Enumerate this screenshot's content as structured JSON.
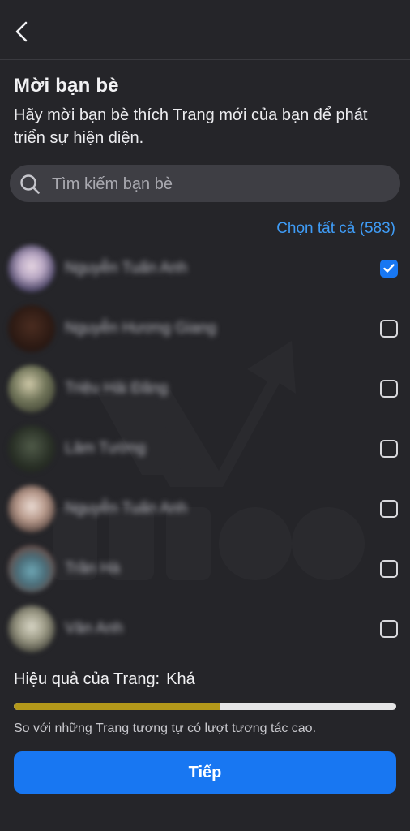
{
  "header": {
    "back_icon": "chevron-left-icon"
  },
  "page": {
    "title": "Mời bạn bè",
    "subtitle": "Hãy mời bạn bè thích Trang mới của bạn để phát triển sự hiện diện."
  },
  "search": {
    "placeholder": "Tìm kiếm bạn bè",
    "icon": "search-icon"
  },
  "select_all": "Chọn tất cả (583)",
  "friends": [
    {
      "name": "Nguyễn Tuấn Anh",
      "checked": true
    },
    {
      "name": "Nguyễn Hương Giang",
      "checked": false
    },
    {
      "name": "Triệu Hải Đăng",
      "checked": false
    },
    {
      "name": "Lâm Tường",
      "checked": false
    },
    {
      "name": "Nguyễn Tuấn Anh",
      "checked": false
    },
    {
      "name": "Trần Hà",
      "checked": false
    },
    {
      "name": "Vân Anh",
      "checked": false
    }
  ],
  "performance": {
    "label": "Hiệu quả của Trang:",
    "value": "Khá",
    "progress": 0.54,
    "note": "So với những Trang tương tự có lượt tương tác cao."
  },
  "next_button": "Tiếp",
  "colors": {
    "accent": "#1877f2",
    "link": "#3f9cf6",
    "progress": "#b3981a",
    "background": "#252529"
  }
}
